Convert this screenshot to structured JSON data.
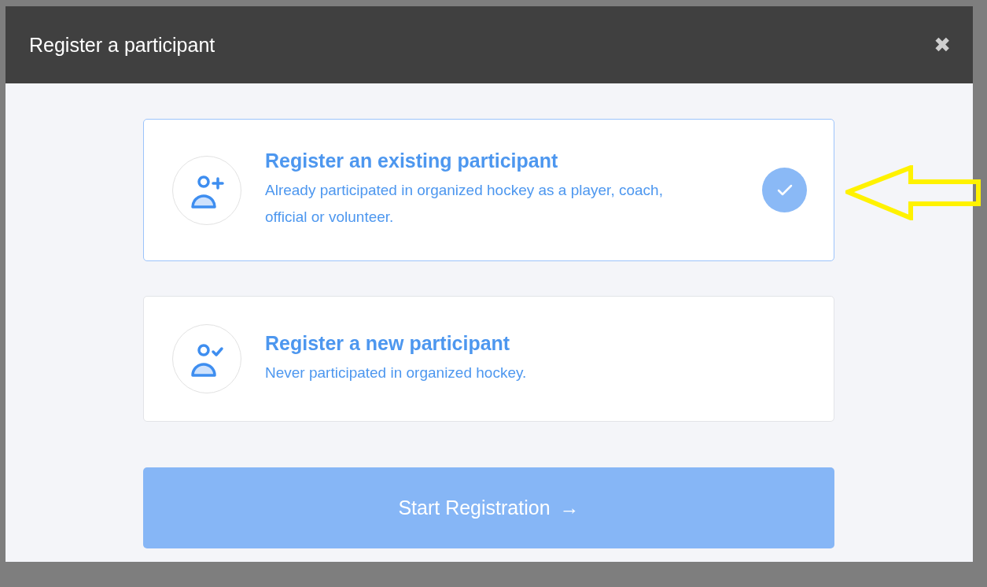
{
  "dialog": {
    "title": "Register a participant",
    "close": "✖"
  },
  "options": [
    {
      "kind": "add",
      "title": "Register an existing participant",
      "description": "Already participated in organized hockey as a player, coach, official or volunteer.",
      "selected": true
    },
    {
      "kind": "verified",
      "title": "Register a new participant",
      "description": "Never participated in organized hockey.",
      "selected": false
    }
  ],
  "start_button": {
    "label": "Start Registration",
    "arrow": "→",
    "disabled": true
  }
}
